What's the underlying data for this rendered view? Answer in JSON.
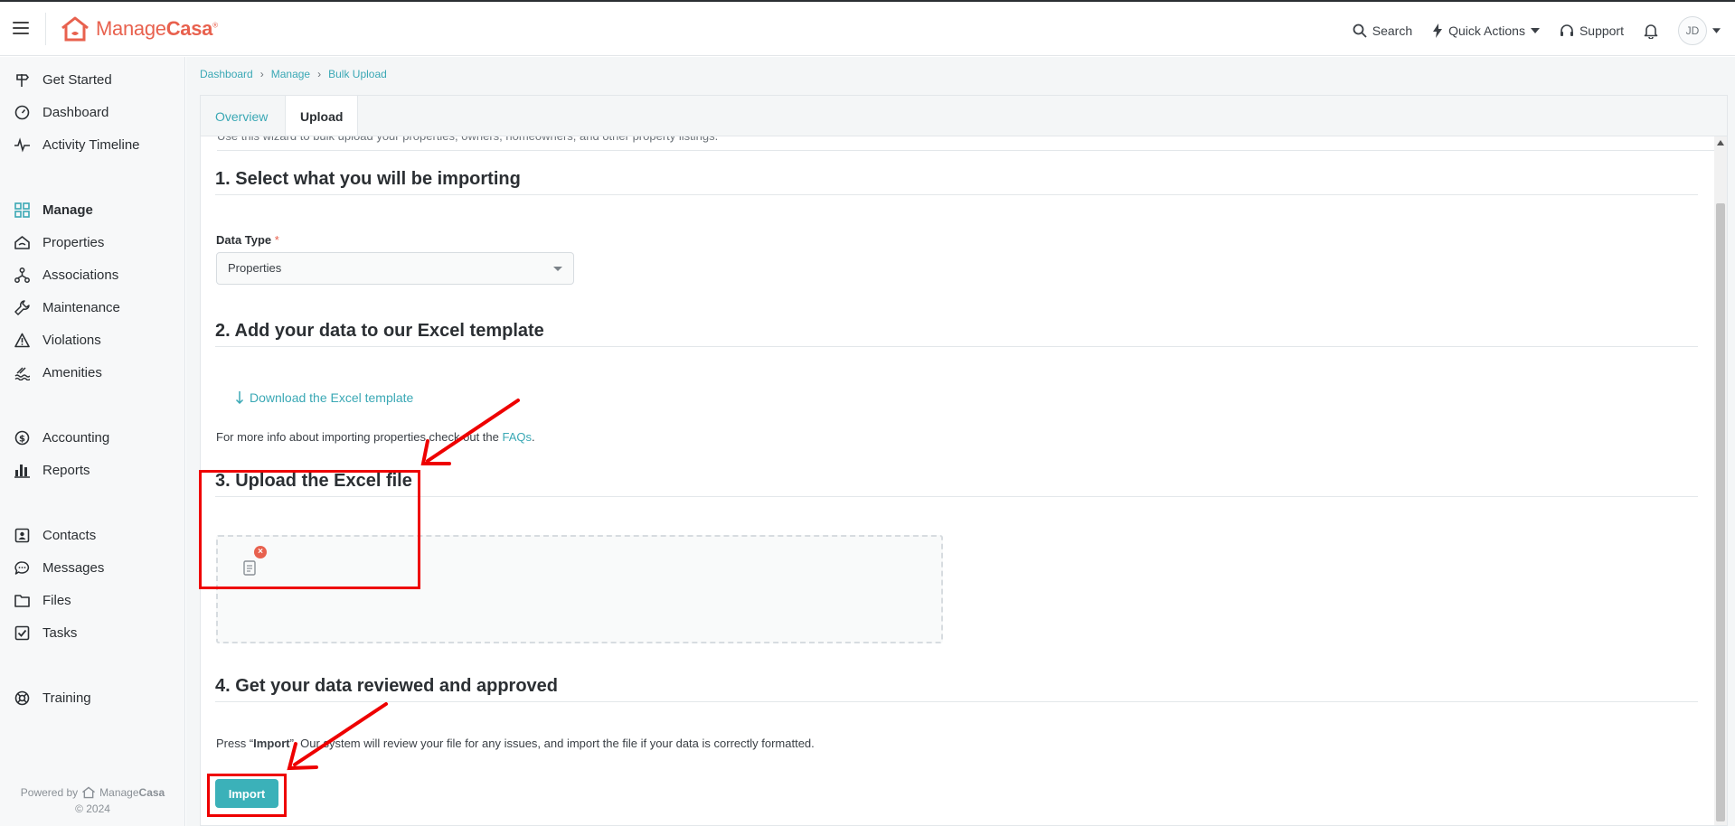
{
  "header": {
    "brand_regular": "Manage",
    "brand_bold": "Casa",
    "brand_mark": "®",
    "search_label": "Search",
    "quick_actions_label": "Quick Actions",
    "support_label": "Support",
    "avatar_initials": "JD"
  },
  "sidebar": {
    "items": [
      {
        "label": "Get Started",
        "icon": "signpost-icon"
      },
      {
        "label": "Dashboard",
        "icon": "gauge-icon"
      },
      {
        "label": "Activity Timeline",
        "icon": "pulse-icon"
      },
      {
        "label": "Manage",
        "icon": "grid-icon"
      },
      {
        "label": "Properties",
        "icon": "house-icon"
      },
      {
        "label": "Associations",
        "icon": "network-icon"
      },
      {
        "label": "Maintenance",
        "icon": "wrench-icon"
      },
      {
        "label": "Violations",
        "icon": "warning-icon"
      },
      {
        "label": "Amenities",
        "icon": "pool-icon"
      },
      {
        "label": "Accounting",
        "icon": "dollar-icon"
      },
      {
        "label": "Reports",
        "icon": "bar-chart-icon"
      },
      {
        "label": "Contacts",
        "icon": "contact-card-icon"
      },
      {
        "label": "Messages",
        "icon": "chat-bubble-icon"
      },
      {
        "label": "Files",
        "icon": "folder-icon"
      },
      {
        "label": "Tasks",
        "icon": "checkbox-icon"
      },
      {
        "label": "Training",
        "icon": "lifebuoy-icon"
      }
    ],
    "powered_by": "Powered by",
    "powered_brand_regular": "Manage",
    "powered_brand_bold": "Casa",
    "copyright": "© 2024"
  },
  "breadcrumb": [
    "Dashboard",
    "Manage",
    "Bulk Upload"
  ],
  "tabs": [
    {
      "label": "Overview",
      "active": false
    },
    {
      "label": "Upload",
      "active": true
    }
  ],
  "content": {
    "cut_off_text": "Use this wizard to bulk upload your properties, owners, homeowners, and other property listings.",
    "section1_title": "1. Select what you will be importing",
    "data_type_label": "Data Type",
    "required_mark": "*",
    "data_type_value": "Properties",
    "section2_title": "2. Add your data to our Excel template",
    "download_link": "Download the Excel template",
    "info_prefix": "For more info about importing properties check out the ",
    "info_link": "FAQs",
    "info_suffix": ".",
    "section3_title": "3. Upload the Excel file",
    "remove_file": "×",
    "section4_title": "4. Get your data reviewed and approved",
    "review_prefix": "Press “",
    "review_bold": "Import",
    "review_suffix": "”. Our system will review your file for any issues, and import the file if your data is correctly formatted.",
    "import_button": "Import"
  },
  "colors": {
    "brand": "#e8614e",
    "accent": "#3aa8b5",
    "button": "#3bb1b9",
    "annotation": "#ee0000"
  }
}
